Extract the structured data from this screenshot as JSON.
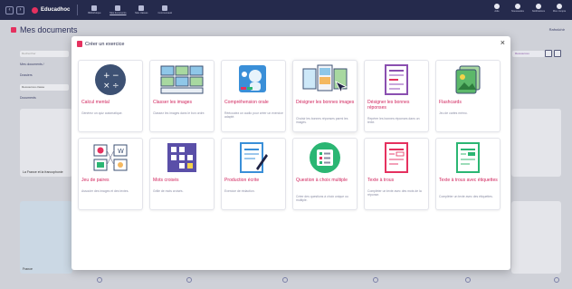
{
  "app": {
    "brand": "Educadhoc",
    "apps": [
      {
        "label": "Bibliothèque"
      },
      {
        "label": "Mes documents"
      },
      {
        "label": "Mes classes"
      },
      {
        "label": "Communauté"
      }
    ],
    "right_items": [
      {
        "label": "Aide"
      },
      {
        "label": "Nouveautés"
      },
      {
        "label": "Notifications"
      },
      {
        "label": "Mon compte"
      }
    ]
  },
  "page": {
    "title": "Mes documents",
    "top_right": "Rafraîchir",
    "side": {
      "search_placeholder": "Rechercher",
      "breadcrumb": "Mes documents /",
      "folders_heading": "Dossiers",
      "folder_item": "Ressources classe",
      "documents_heading": "Documents"
    },
    "filter_label": "Ressources",
    "tiles": [
      {
        "caption": "La France et la francophonie"
      },
      {
        "caption": "France"
      }
    ]
  },
  "modal": {
    "title": "Créer un exercice",
    "close_label": "×",
    "cards": [
      {
        "name": "calcul-mental",
        "title": "Calcul mental",
        "desc": "Générez un quiz automatique."
      },
      {
        "name": "classer-images",
        "title": "Classer les images",
        "desc": "Classez les images dans le bon ordre."
      },
      {
        "name": "comprehension-orale",
        "title": "Compréhension orale",
        "desc": "Réécoutez un audio pour créer un exercice adapté."
      },
      {
        "name": "designer-bonnes-images",
        "title": "Désigner les bonnes images",
        "desc": "Choisir les bonnes réponses parmi les images."
      },
      {
        "name": "designer-bonnes-reponses",
        "title": "Désigner les bonnes réponses",
        "desc": "Repérer les bonnes réponses dans un texte."
      },
      {
        "name": "flashcards",
        "title": "Flashcards",
        "desc": "Jeu de cartes mémo."
      },
      {
        "name": "jeu-de-paires",
        "title": "Jeu de paires",
        "desc": "Associer des images et des textes."
      },
      {
        "name": "mots-croises",
        "title": "Mots croisés",
        "desc": "Grille de mots croisés."
      },
      {
        "name": "production-ecrite",
        "title": "Production écrite",
        "desc": "Exercice de rédaction."
      },
      {
        "name": "question-choix-multiple",
        "title": "Question à choix multiple",
        "desc": "Créer des questions à choix unique ou multiple."
      },
      {
        "name": "texte-a-trous",
        "title": "Texte à trous",
        "desc": "Compléter un texte avec des mots de la réponse."
      },
      {
        "name": "texte-trous-etiquettes",
        "title": "Texte à trous avec étiquettes",
        "desc": "Compléter un texte avec des étiquettes."
      }
    ]
  },
  "colors": {
    "topbar": "#252a4c",
    "accent": "#d1245d",
    "card_border": "#e3e4ea"
  }
}
